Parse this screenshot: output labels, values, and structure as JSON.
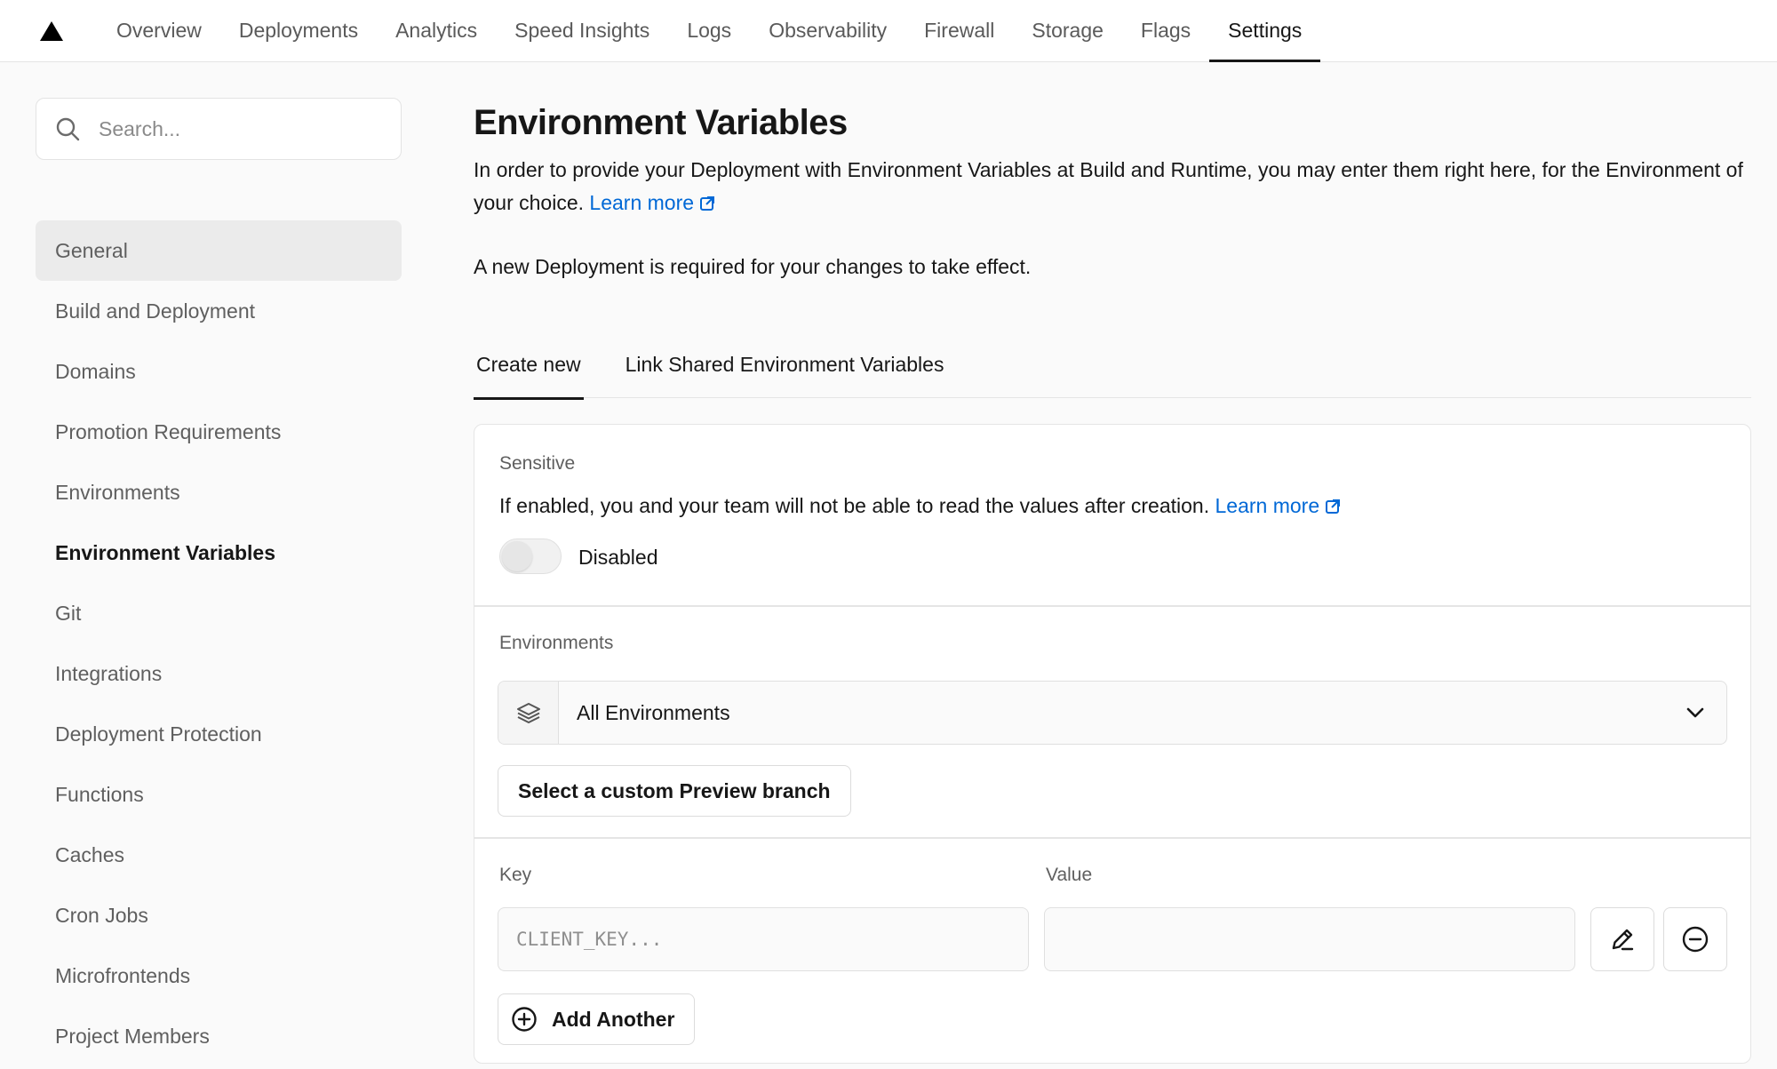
{
  "topnav": {
    "tabs": [
      {
        "label": "Overview"
      },
      {
        "label": "Deployments"
      },
      {
        "label": "Analytics"
      },
      {
        "label": "Speed Insights"
      },
      {
        "label": "Logs"
      },
      {
        "label": "Observability"
      },
      {
        "label": "Firewall"
      },
      {
        "label": "Storage"
      },
      {
        "label": "Flags"
      },
      {
        "label": "Settings"
      }
    ],
    "active": "Settings"
  },
  "sidebar": {
    "search_placeholder": "Search...",
    "items": [
      {
        "label": "General"
      },
      {
        "label": "Build and Deployment"
      },
      {
        "label": "Domains"
      },
      {
        "label": "Promotion Requirements"
      },
      {
        "label": "Environments"
      },
      {
        "label": "Environment Variables"
      },
      {
        "label": "Git"
      },
      {
        "label": "Integrations"
      },
      {
        "label": "Deployment Protection"
      },
      {
        "label": "Functions"
      },
      {
        "label": "Caches"
      },
      {
        "label": "Cron Jobs"
      },
      {
        "label": "Microfrontends"
      },
      {
        "label": "Project Members"
      }
    ],
    "current": "Environment Variables"
  },
  "main": {
    "title": "Environment Variables",
    "description": "In order to provide your Deployment with Environment Variables at Build and Runtime, you may enter them right here, for the Environment of your choice.",
    "learn_more": "Learn more",
    "note": "A new Deployment is required for your changes to take effect.",
    "tabs": [
      {
        "label": "Create new"
      },
      {
        "label": "Link Shared Environment Variables"
      }
    ],
    "sensitive": {
      "label": "Sensitive",
      "text": "If enabled, you and your team will not be able to read the values after creation.",
      "learn_more": "Learn more",
      "toggle_label": "Disabled"
    },
    "environments": {
      "label": "Environments",
      "selected": "All Environments",
      "custom_branch_button": "Select a custom Preview branch"
    },
    "kv": {
      "key_label": "Key",
      "value_label": "Value",
      "key_placeholder": "CLIENT_KEY...",
      "value_placeholder": "",
      "add_another": "Add Another"
    }
  },
  "colors": {
    "link": "#0068d6",
    "text": "#171717",
    "muted": "#5f5f5f",
    "background": "#fafafa"
  }
}
